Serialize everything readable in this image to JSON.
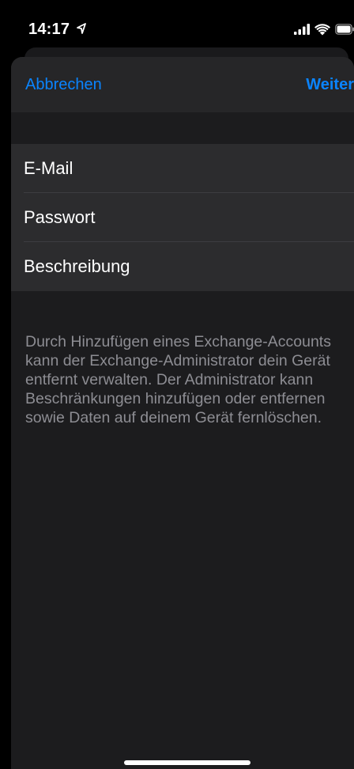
{
  "status_bar": {
    "time": "14:17",
    "location_icon": "location-arrow-icon",
    "signal_icon": "cellular-signal-icon",
    "wifi_icon": "wifi-icon",
    "battery_icon": "battery-icon"
  },
  "nav": {
    "cancel_label": "Abbrechen",
    "next_label": "Weiter"
  },
  "form": {
    "fields": [
      {
        "label": "E-Mail"
      },
      {
        "label": "Passwort"
      },
      {
        "label": "Beschreibung"
      }
    ]
  },
  "footer": {
    "lines": [
      "Durch Hinzufügen eines Exchange-Accounts",
      "kann der Exchange-Administrator dein Gerät",
      "entfernt verwalten. Der Administrator kann",
      "Beschränkungen hinzufügen oder entfernen",
      "sowie Daten auf deinem Gerät fernlöschen."
    ]
  },
  "colors": {
    "accent": "#0a84ff",
    "background": "#000000",
    "sheet": "#1c1c1e",
    "nav_bar": "#262628",
    "cell": "#2c2c2e",
    "footer_text": "#8d8d93"
  }
}
